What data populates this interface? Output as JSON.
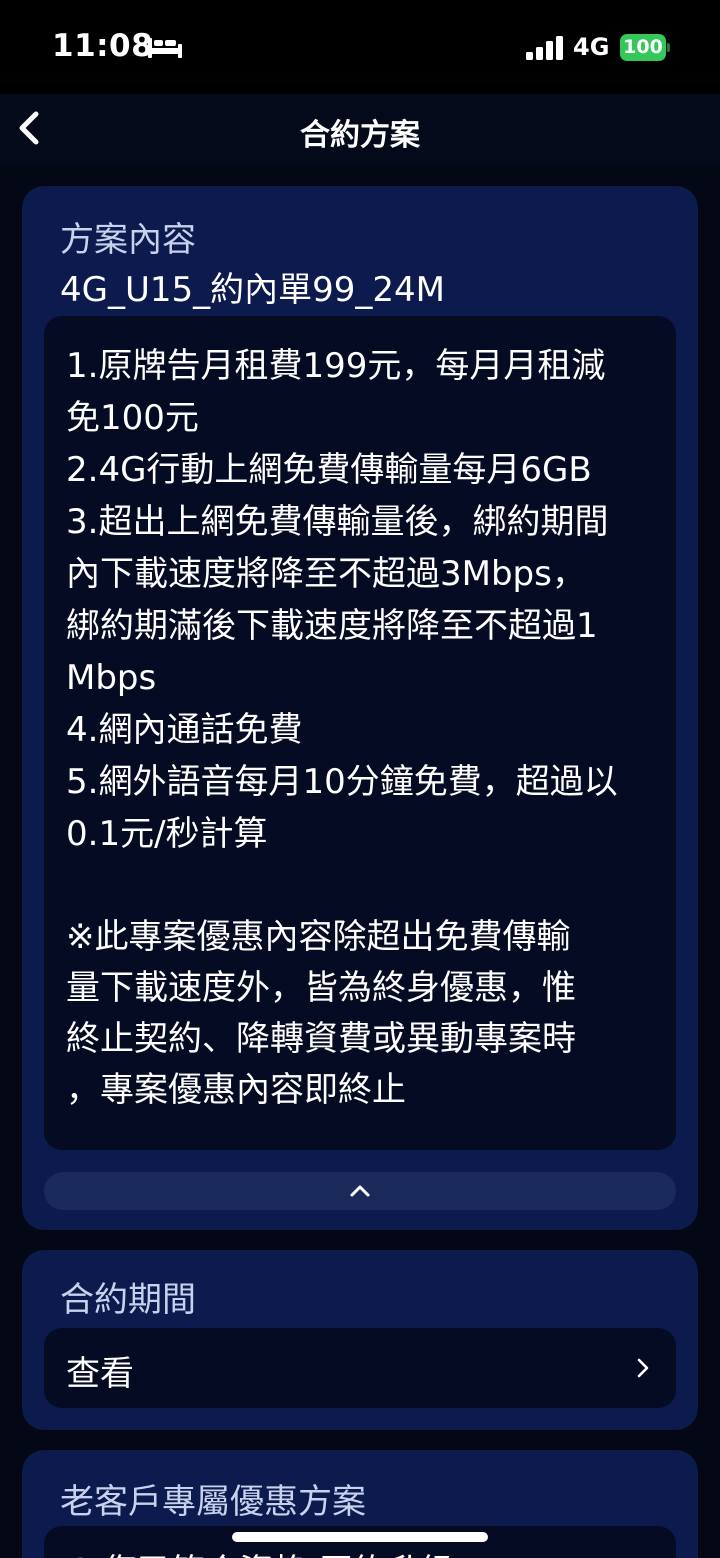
{
  "status_bar": {
    "time": "11:08",
    "network": "4G",
    "battery": "100",
    "colors": {
      "battery": "#34c759"
    },
    "icons": [
      "bed-icon",
      "signal-icon",
      "battery-icon"
    ]
  },
  "nav": {
    "title": "合約方案",
    "back_icon": "chevron-left-icon"
  },
  "plan_card": {
    "heading": "方案內容",
    "plan_code": "4G_U15_約內單99_24M",
    "details_lines": [
      "1.原牌告月租費199元，每月月租減",
      "免100元",
      "2.4G行動上網免費傳輸量每月6GB",
      "3.超出上網免費傳輸量後，綁約期間",
      "內下載速度將降至不超過3Mbps，",
      "綁約期滿後下載速度將降至不超過1",
      "Mbps",
      "4.網內通話免費",
      "5.網外語音每月10分鐘免費，超過以",
      "0.1元/秒計算"
    ],
    "note_lines": [
      "※此專案優惠內容除超出免費傳輸",
      "量下載速度外，皆為終身優惠，惟",
      "終止契約、降轉資費或異動專案時",
      "，專案優惠內容即終止"
    ],
    "collapse_icon": "chevron-up-icon"
  },
  "period_card": {
    "heading": "合約期間",
    "row_label": "查看",
    "row_icon": "chevron-right-icon"
  },
  "offers_card": {
    "heading": "老客戶專屬優惠方案",
    "row_partial": "G  您已符合資格  原約升級"
  },
  "colors": {
    "background": "#040814",
    "card": "#0c1a4d",
    "inner_panel": "#050b22",
    "heading_text": "#c8d2ee"
  }
}
